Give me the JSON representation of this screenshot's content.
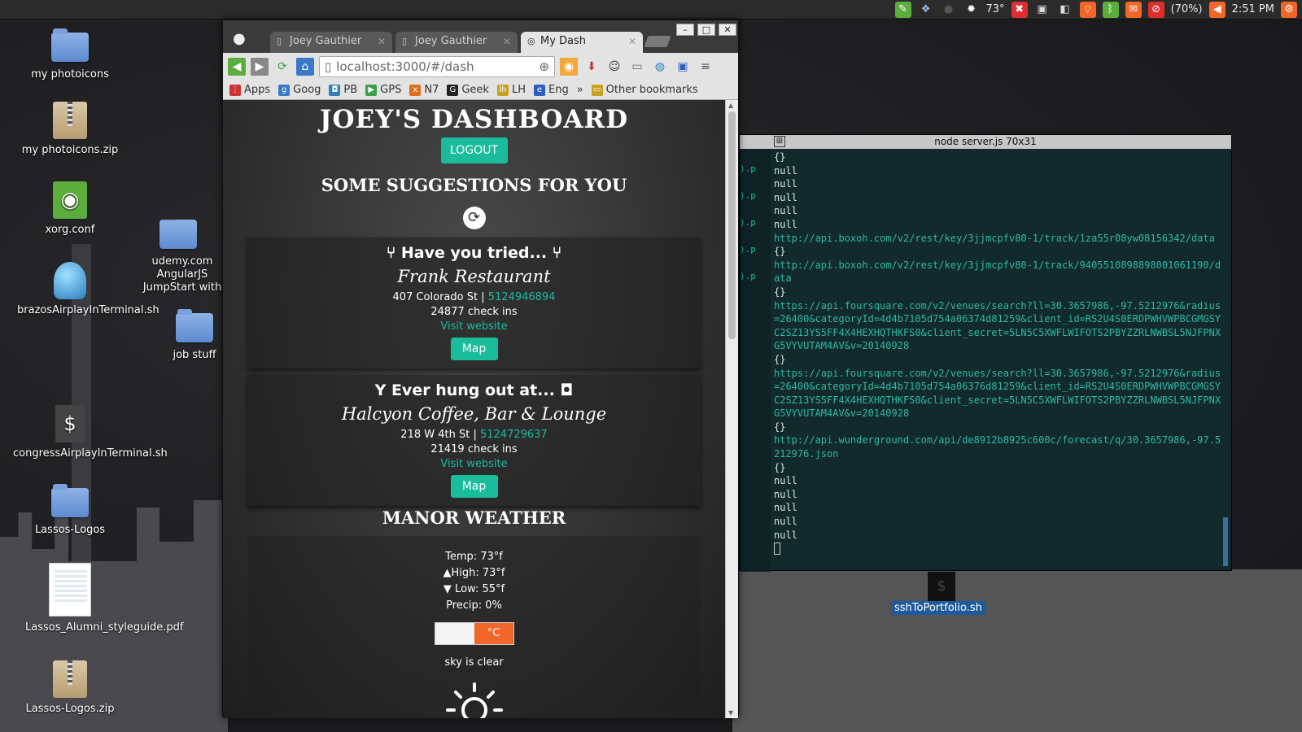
{
  "panel": {
    "temperature": "73°",
    "battery": "(70%)",
    "clock": "2:51 PM",
    "icons": [
      "evernote-icon",
      "dropbox-icon",
      "moon-icon",
      "weather-icon",
      "x-icon",
      "clipboard-icon",
      "sound-icon",
      "wifi-icon",
      "bluetooth-icon",
      "mail-icon",
      "battery-icon",
      "volume-icon",
      "gear-icon"
    ]
  },
  "desktop": {
    "icons": [
      {
        "label": "my photoicons"
      },
      {
        "label": "my photoicons.zip"
      },
      {
        "label": "xorg.conf"
      },
      {
        "label": "brazosAirplayInTerminal.sh"
      },
      {
        "label": "congressAirplayInTerminal.sh"
      },
      {
        "label": "Lassos-Logos"
      },
      {
        "label": "Lassos_Alumni_styleguide.pdf"
      },
      {
        "label": "Lassos-Logos.zip"
      },
      {
        "label": "udemy.com AngularJS JumpStart with"
      },
      {
        "label": "job stuff"
      },
      {
        "label": "sshToPortfolio.sh"
      }
    ]
  },
  "browser": {
    "tabs": [
      {
        "label": "Joey Gauthier"
      },
      {
        "label": "Joey Gauthier"
      },
      {
        "label": "My Dash"
      }
    ],
    "url": "localhost:3000/#/dash",
    "bookmarks": [
      "Apps",
      "Goog",
      "PB",
      "GPS",
      "N7",
      "Geek",
      "LH",
      "Eng",
      "»",
      "Other bookmarks"
    ]
  },
  "dashboard": {
    "title": "JOEY'S DASHBOARD",
    "logout": "LOGOUT",
    "suggestions_title": "SOME SUGGESTIONS FOR YOU",
    "suggestions": [
      {
        "heading": "Have you tried...",
        "name": "Frank Restaurant",
        "address": "407 Colorado St |",
        "phone": "5124946894",
        "checkins": "24877 check ins",
        "website": "Visit website",
        "map": "Map"
      },
      {
        "heading": "Ever hung out at...",
        "name": "Halcyon Coffee, Bar & Lounge",
        "address": "218 W 4th St |",
        "phone": "5124729637",
        "checkins": "21419 check ins",
        "website": "Visit website",
        "map": "Map"
      }
    ],
    "weather": {
      "title": "MANOR WEATHER",
      "temp": "Temp: 73°f",
      "high": "▲High: 73°f",
      "low": "▼ Low: 55°f",
      "precip": "Precip: 0%",
      "unit": "°C",
      "sky": "sky is clear"
    }
  },
  "terminal": {
    "title": "node server.js 70x31",
    "left_fragments": [
      ").p",
      ").p",
      ").p",
      ").p",
      ").p"
    ],
    "lines": [
      {
        "t": "{}",
        "c": "plain"
      },
      {
        "t": "null",
        "c": "plain"
      },
      {
        "t": "null",
        "c": "plain"
      },
      {
        "t": "null",
        "c": "plain"
      },
      {
        "t": "null",
        "c": "plain"
      },
      {
        "t": "null",
        "c": "plain"
      },
      {
        "t": "http://api.boxoh.com/v2/rest/key/3jjmcpfv80-1/track/1za55r08yw08156342/data",
        "c": "url"
      },
      {
        "t": "{}",
        "c": "plain"
      },
      {
        "t": "http://api.boxoh.com/v2/rest/key/3jjmcpfv80-1/track/9405510898898001061190/data",
        "c": "url"
      },
      {
        "t": "{}",
        "c": "plain"
      },
      {
        "t": "https://api.foursquare.com/v2/venues/search?ll=30.3657986,-97.5212976&radius=26400&categoryId=4d4b7105d754a06374d81259&client_id=RS2U4S0ERDPWHVWPBCGMGSYC2SZ13YS5FF4X4HEXHQTHKFS0&client_secret=5LN5C5XWFLWIFOTS2PBYZZRLNWBSL5NJFPNXG5VYVUTAM4AV&v=20140928",
        "c": "url"
      },
      {
        "t": "{}",
        "c": "plain"
      },
      {
        "t": "https://api.foursquare.com/v2/venues/search?ll=30.3657986,-97.5212976&radius=26400&categoryId=4d4b7105d754a06376d81259&client_id=RS2U4S0ERDPWHVWPBCGMGSYC2SZ13YS5FF4X4HEXHQTHKFS0&client_secret=5LN5C5XWFLWIFOTS2PBYZZRLNWBSL5NJFPNXG5VYVUTAM4AV&v=20140928",
        "c": "url"
      },
      {
        "t": "{}",
        "c": "plain"
      },
      {
        "t": "http://api.wunderground.com/api/de8912b8925c600c/forecast/q/30.3657986,-97.5212976.json",
        "c": "url"
      },
      {
        "t": "{}",
        "c": "plain"
      },
      {
        "t": "null",
        "c": "plain"
      },
      {
        "t": "null",
        "c": "plain"
      },
      {
        "t": "null",
        "c": "plain"
      },
      {
        "t": "null",
        "c": "plain"
      },
      {
        "t": "null",
        "c": "plain"
      }
    ]
  },
  "colors": {
    "accent": "#1abc9c",
    "unit_toggle": "#f2662a",
    "terminal_bg": "#122a2c"
  }
}
